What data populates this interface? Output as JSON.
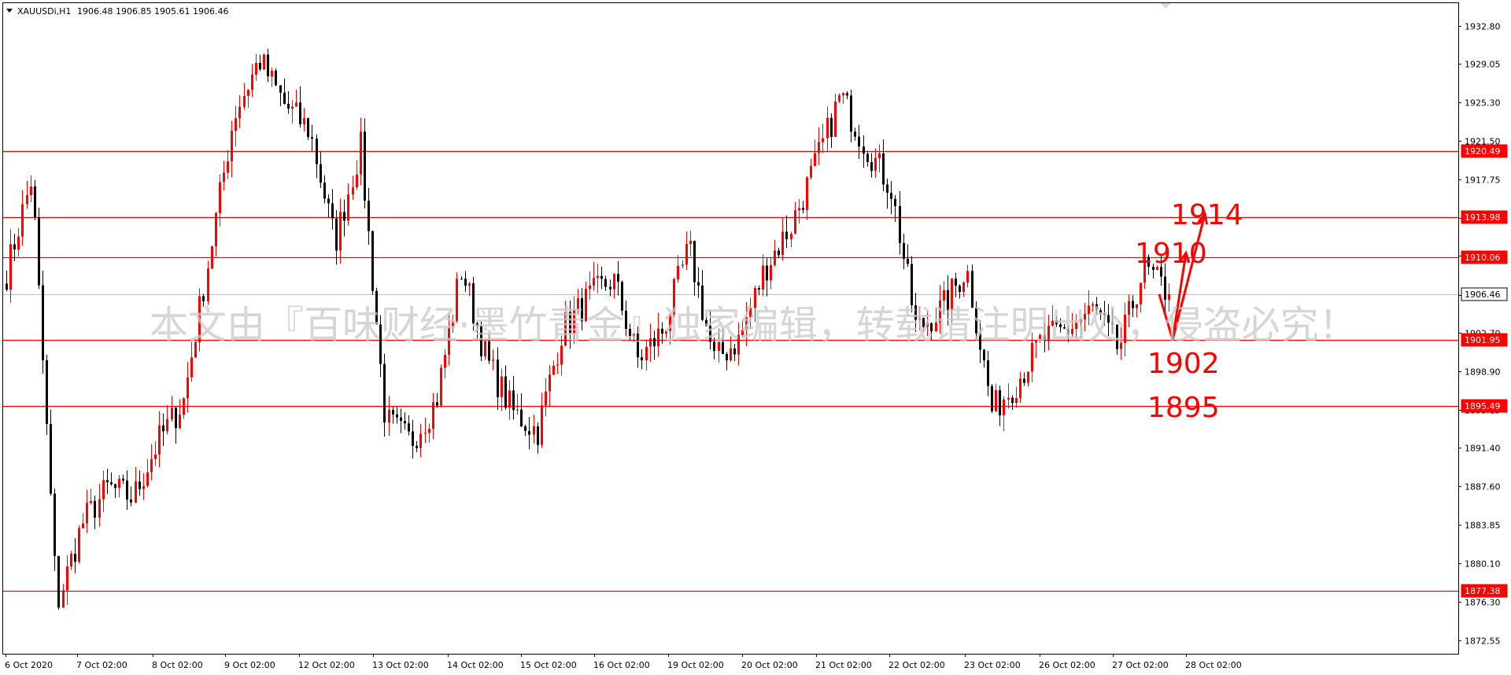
{
  "header": {
    "symbol": "XAUUSDi,H1",
    "quote": "1906.48 1906.85 1905.61 1906.46"
  },
  "price_axis": [
    "1932.80",
    "1929.05",
    "1925.30",
    "1921.50",
    "1917.75",
    "1913.95",
    "1910.20",
    "1906.40",
    "1902.70",
    "1898.90",
    "1895.15",
    "1891.40",
    "1887.60",
    "1883.85",
    "1880.10",
    "1876.30",
    "1872.55"
  ],
  "time_axis": [
    "6 Oct 2020",
    "7 Oct 02:00",
    "8 Oct 02:00",
    "9 Oct 02:00",
    "12 Oct 02:00",
    "13 Oct 02:00",
    "14 Oct 02:00",
    "15 Oct 02:00",
    "16 Oct 02:00",
    "19 Oct 02:00",
    "20 Oct 02:00",
    "21 Oct 02:00",
    "22 Oct 02:00",
    "23 Oct 02:00",
    "26 Oct 02:00",
    "27 Oct 02:00",
    "28 Oct 02:00"
  ],
  "current_price": "1906.46",
  "levels": [
    {
      "label": "1920.49",
      "price": 1920.49
    },
    {
      "label": "1913.98",
      "price": 1913.98
    },
    {
      "label": "1910.06",
      "price": 1910.06
    },
    {
      "label": "1901.95",
      "price": 1901.95
    },
    {
      "label": "1895.49",
      "price": 1895.49
    },
    {
      "label": "1877.38",
      "price": 1877.38
    }
  ],
  "annotations": [
    "1914",
    "1910",
    "1902",
    "1895"
  ],
  "watermark": "本文由『百味财经·墨竹青金』独家编辑，转载请注明出处，侵盗必究！",
  "colors": {
    "bull": "#ff0000",
    "bear": "#000000",
    "level": "#ff0000",
    "tag_bg": "#ff0000",
    "current_line": "#c0c0c0"
  },
  "chart_data": {
    "type": "candlestick",
    "symbol": "XAUUSDi",
    "timeframe": "H1",
    "ylim": [
      1871.2,
      1935.0
    ],
    "grid": false,
    "ohlc_anchors": [
      {
        "t": "6 Oct 2020",
        "close": 1908.5
      },
      {
        "t": "6 Oct late",
        "close": 1918.0
      },
      {
        "t": "7 Oct 00:00",
        "close": 1876.0
      },
      {
        "t": "7 Oct 02:00",
        "close": 1884.0
      },
      {
        "t": "7 Oct mid",
        "close": 1887.5
      },
      {
        "t": "8 Oct 02:00",
        "close": 1886.5
      },
      {
        "t": "8 Oct mid",
        "close": 1892.0
      },
      {
        "t": "8 Oct late",
        "close": 1896.0
      },
      {
        "t": "9 Oct 02:00",
        "close": 1910.0
      },
      {
        "t": "9 Oct mid",
        "close": 1924.0
      },
      {
        "t": "9 Oct late",
        "close": 1929.5
      },
      {
        "t": "12 Oct 02:00",
        "close": 1925.0
      },
      {
        "t": "12 Oct mid",
        "close": 1922.5
      },
      {
        "t": "12 Oct late",
        "close": 1911.5
      },
      {
        "t": "12 Oct close",
        "close": 1921.0
      },
      {
        "t": "13 Oct 02:00",
        "close": 1894.0
      },
      {
        "t": "13 Oct mid",
        "close": 1892.0
      },
      {
        "t": "14 Oct 02:00",
        "close": 1896.0
      },
      {
        "t": "14 Oct mid",
        "close": 1909.0
      },
      {
        "t": "14 Oct late",
        "close": 1900.0
      },
      {
        "t": "15 Oct 02:00",
        "close": 1895.0
      },
      {
        "t": "15 Oct mid",
        "close": 1893.0
      },
      {
        "t": "15 Oct late",
        "close": 1903.0
      },
      {
        "t": "16 Oct 02:00",
        "close": 1906.0
      },
      {
        "t": "16 Oct mid",
        "close": 1908.0
      },
      {
        "t": "16 Oct late",
        "close": 1900.0
      },
      {
        "t": "19 Oct 02:00",
        "close": 1903.0
      },
      {
        "t": "19 Oct mid",
        "close": 1911.0
      },
      {
        "t": "19 Oct late",
        "close": 1900.0
      },
      {
        "t": "20 Oct 02:00",
        "close": 1902.0
      },
      {
        "t": "20 Oct mid",
        "close": 1909.0
      },
      {
        "t": "20 Oct late",
        "close": 1913.0
      },
      {
        "t": "21 Oct 02:00",
        "close": 1919.0
      },
      {
        "t": "21 Oct mid",
        "close": 1926.0
      },
      {
        "t": "21 Oct late",
        "close": 1921.0
      },
      {
        "t": "22 Oct 02:00",
        "close": 1917.0
      },
      {
        "t": "22 Oct mid",
        "close": 1903.0
      },
      {
        "t": "22 Oct late",
        "close": 1905.0
      },
      {
        "t": "23 Oct 02:00",
        "close": 1909.0
      },
      {
        "t": "23 Oct mid",
        "close": 1895.0
      },
      {
        "t": "23 Oct late",
        "close": 1898.0
      },
      {
        "t": "26 Oct 02:00",
        "close": 1902.0
      },
      {
        "t": "26 Oct mid",
        "close": 1903.0
      },
      {
        "t": "26 Oct late",
        "close": 1905.0
      },
      {
        "t": "27 Oct 02:00",
        "close": 1901.0
      },
      {
        "t": "27 Oct mid",
        "close": 1909.0
      },
      {
        "t": "28 Oct",
        "close": 1906.46
      }
    ],
    "projection": [
      {
        "label": "1902",
        "price": 1902
      },
      {
        "label": "1910",
        "price": 1910
      },
      {
        "label": "1914",
        "price": 1914
      }
    ]
  }
}
